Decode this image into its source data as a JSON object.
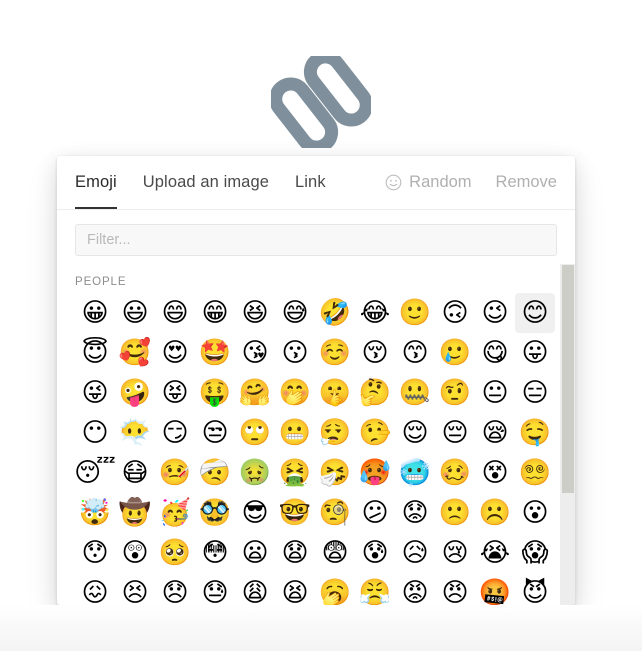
{
  "page": {
    "background_color": "#ffffff",
    "link_icon": {
      "name": "chain-link-icon",
      "color": "#7f909c"
    }
  },
  "picker": {
    "accent_color": "#333333",
    "tabs": [
      {
        "label": "Emoji",
        "active": true
      },
      {
        "label": "Upload an image",
        "active": false
      },
      {
        "label": "Link",
        "active": false
      }
    ],
    "actions": [
      {
        "label": "Random",
        "icon": "smiley-outline-icon"
      },
      {
        "label": "Remove",
        "icon": null
      }
    ],
    "filter": {
      "value": "",
      "placeholder": "Filter..."
    },
    "groups": [
      {
        "title": "PEOPLE",
        "rows": [
          [
            "😀",
            "😃",
            "😄",
            "😁",
            "😆",
            "😅",
            "🤣",
            "😂",
            "🙂",
            "🙃",
            "😉",
            "😊"
          ],
          [
            "😇",
            "🥰",
            "😍",
            "🤩",
            "😘",
            "😗",
            "☺️",
            "😚",
            "😙",
            "🥲",
            "😋",
            "😛"
          ],
          [
            "😜",
            "🤪",
            "😝",
            "🤑",
            "🤗",
            "🤭",
            "🤫",
            "🤔",
            "🤐",
            "🤨",
            "😐",
            "😑"
          ],
          [
            "😶",
            "😶‍🌫️",
            "😏",
            "😒",
            "🙄",
            "😬",
            "😮‍💨",
            "🤥",
            "😌",
            "😔",
            "😪",
            "🤤"
          ],
          [
            "😴",
            "😷",
            "🤒",
            "🤕",
            "🤢",
            "🤮",
            "🤧",
            "🥵",
            "🥶",
            "🥴",
            "😵",
            "😵‍💫"
          ],
          [
            "🤯",
            "🤠",
            "🥳",
            "🥸",
            "😎",
            "🤓",
            "🧐",
            "😕",
            "😟",
            "🙁",
            "☹️",
            "😮"
          ],
          [
            "😯",
            "😲",
            "🥺",
            "😳",
            "😦",
            "😧",
            "😨",
            "😰",
            "😥",
            "😢",
            "😭",
            "😱"
          ],
          [
            "😖",
            "😣",
            "😞",
            "😓",
            "😩",
            "😫",
            "🥱",
            "😤",
            "😡",
            "😠",
            "🤬",
            "😈"
          ]
        ],
        "hovered_cell": {
          "row": 0,
          "col": 11
        }
      }
    ],
    "scrollbar": {
      "thumb_color": "#cdcdc8",
      "track_color": "#ededed"
    }
  }
}
